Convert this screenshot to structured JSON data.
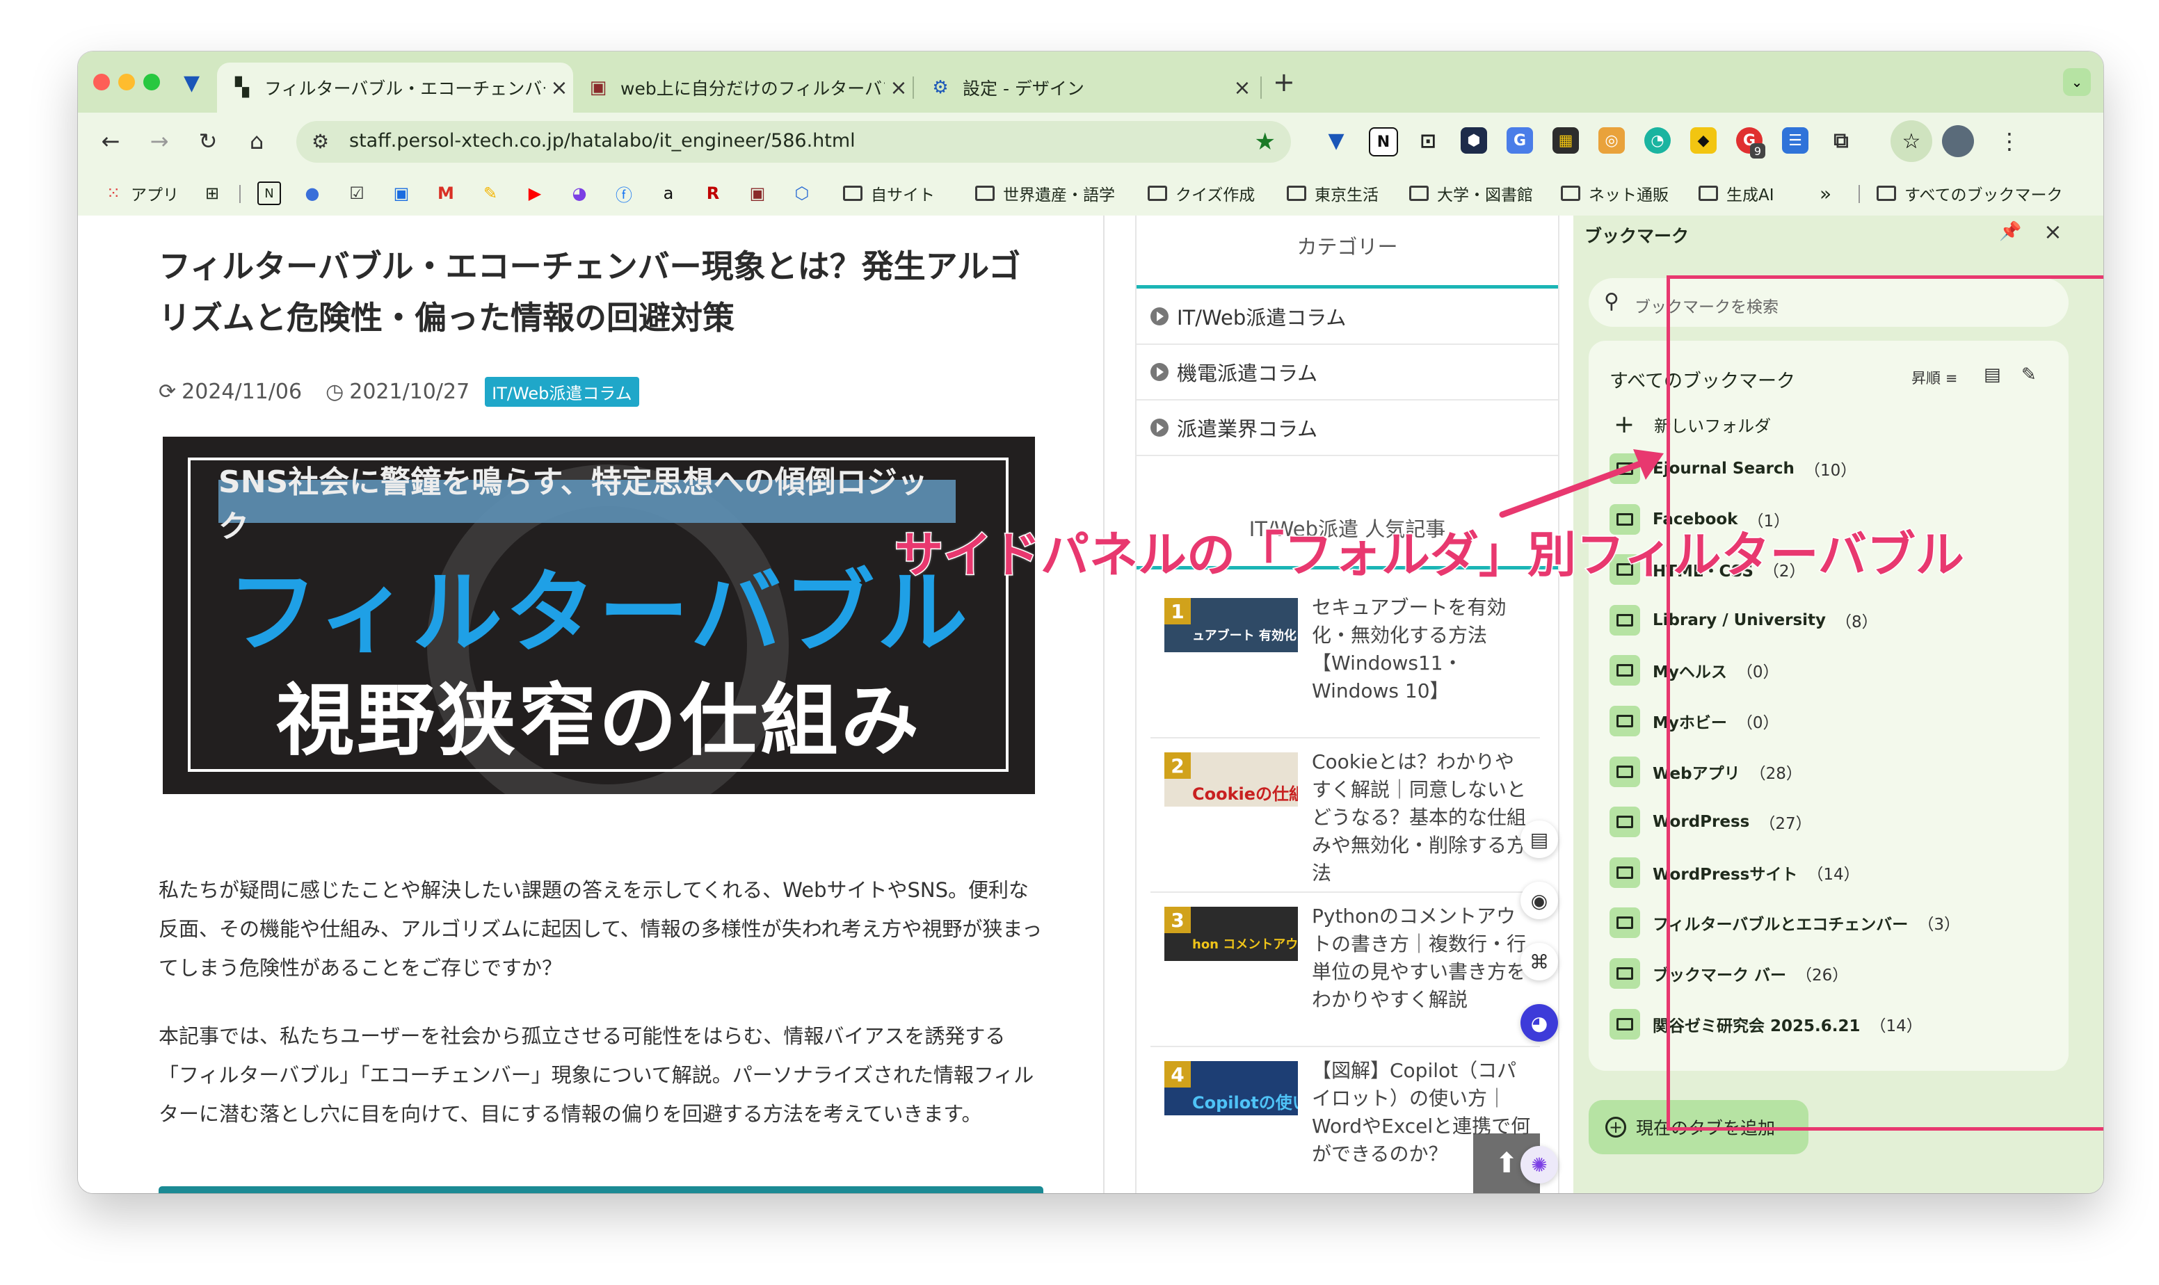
{
  "tabs": [
    {
      "title": "フィルターバブル・エコーチェンバー現象とは？発生アルゴリズムと危険性",
      "active": true
    },
    {
      "title": "web上に自分だけのフィルターバブル",
      "active": false
    },
    {
      "title": "設定 - デザイン",
      "active": false
    }
  ],
  "toolbar": {
    "url": "staff.persol-xtech.co.jp/hatalabo/it_engineer/586.html",
    "ext_badge": "9"
  },
  "bookmarks_bar": {
    "items": [
      "アプリ",
      "自サイト",
      "世界遺産・語学",
      "クイズ作成",
      "東京生活",
      "大学・図書館",
      "ネット通販",
      "生成AI"
    ],
    "overflow": "»",
    "all_bookmarks": "すべてのブックマーク"
  },
  "article": {
    "title": "フィルターバブル・エコーチェンバー現象とは？発生アルゴリズムと危険性・偏った情報の回避対策",
    "updated": "2024/11/06",
    "published": "2021/10/27",
    "category": "IT/Web派遣コラム",
    "hero_ribbon": "SNS社会に警鐘を鳴らす、特定思想への傾倒ロジック",
    "hero_line1": "フィルターバブル",
    "hero_line2": "視野狭窄の仕組み",
    "para1": "私たちが疑問に感じたことや解決したい課題の答えを示してくれる、WebサイトやSNS。便利な反面、その機能や仕組み、アルゴリズムに起因して、情報の多様性が失われ考え方や視野が狭まってしまう危険性があることをご存じですか？",
    "para2": "本記事では、私たちユーザーを社会から孤立させる可能性をはらむ、情報バイアスを誘発する「フィルターバブル」「エコーチェンバー」現象について解説。パーソナライズされた情報フィルターに潜む落とし穴に目を向けて、目にする情報の偏りを回避する方法を考えていきます。"
  },
  "sidebar": {
    "category_heading": "カテゴリー",
    "categories": [
      "IT/Web派遣コラム",
      "機電派遣コラム",
      "派遣業界コラム"
    ],
    "popular_heading": "IT/Web派遣 人気記事",
    "popular": [
      {
        "rank": "1",
        "thumb": "ュアブート 有効化・無効化の方法",
        "title": "セキュアブートを有効化・無効化する方法【Windows11・Windows 10】"
      },
      {
        "rank": "2",
        "thumb": "Cookieの仕組み",
        "title": "Cookieとは？わかりやすく解説｜同意しないとどうなる？基本的な仕組みや無効化・削除する方法"
      },
      {
        "rank": "3",
        "thumb": "hon コメントアウトの書き方",
        "title": "Pythonのコメントアウトの書き方｜複数行・行単位の見やすい書き方をわかりやすく解説"
      },
      {
        "rank": "4",
        "thumb": "Copilotの使い方",
        "title": "【図解】Copilot（コパイロット）の使い方｜WordやExcelと連携で何ができるのか？"
      }
    ]
  },
  "bookmark_panel": {
    "title": "ブックマーク",
    "search_placeholder": "ブックマークを検索",
    "list_heading": "すべてのブックマーク",
    "sort_label": "昇順",
    "new_folder": "新しいフォルダ",
    "folders": [
      {
        "name": "Ejournal Search",
        "count": "（10）"
      },
      {
        "name": "Facebook",
        "count": "（1）"
      },
      {
        "name": "HTML・CSS",
        "count": "（2）"
      },
      {
        "name": "Library / University",
        "count": "（8）"
      },
      {
        "name": "Myヘルス",
        "count": "（0）"
      },
      {
        "name": "Myホビー",
        "count": "（0）"
      },
      {
        "name": "Webアプリ",
        "count": "（28）"
      },
      {
        "name": "WordPress",
        "count": "（27）"
      },
      {
        "name": "WordPressサイト",
        "count": "（14）"
      },
      {
        "name": "フィルターバブルとエコチェンバー",
        "count": "（3）"
      },
      {
        "name": "ブックマーク バー",
        "count": "（26）"
      },
      {
        "name": "関谷ゼミ研究会 2025.6.21",
        "count": "（14）"
      }
    ],
    "add_tab": "現在のタブを追加"
  },
  "annotation": {
    "caption": "サイドパネルの「フォルダ」別フィルターバブル",
    "color": "#e8386f"
  }
}
